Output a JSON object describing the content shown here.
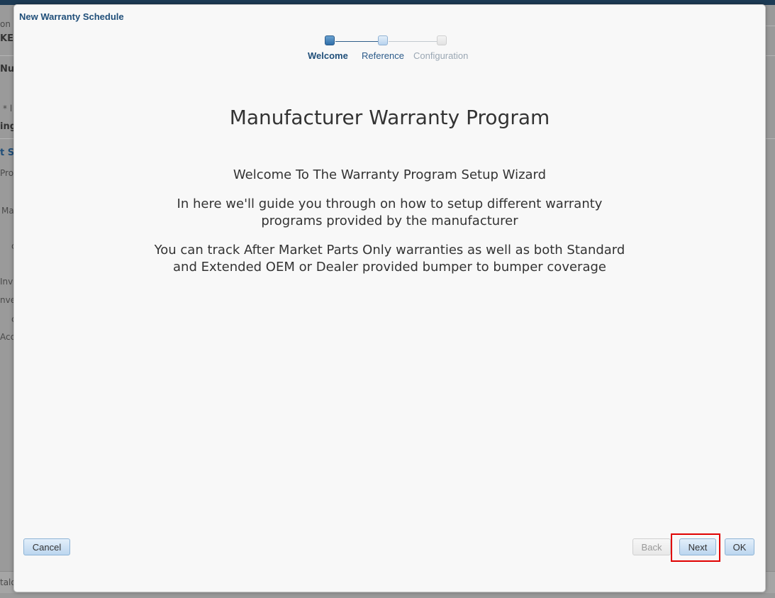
{
  "background": {
    "fragments": [
      "on",
      "KET",
      "Nu",
      "* l",
      "ing",
      "t Se",
      "Pro",
      "Ma",
      "c",
      "Inv",
      "nve",
      "c",
      "Acc",
      "talo"
    ]
  },
  "dialog": {
    "title": "New Warranty Schedule",
    "train": {
      "steps": [
        {
          "label": "Welcome",
          "state": "current"
        },
        {
          "label": "Reference",
          "state": "next"
        },
        {
          "label": "Configuration",
          "state": "disabled"
        }
      ]
    },
    "heading": "Manufacturer Warranty Program",
    "paragraphs": [
      "Welcome To The Warranty Program Setup Wizard",
      "In here we'll guide you through on how to setup different warranty programs provided by the manufacturer",
      "You can track After Market Parts Only warranties as well as both Standard and Extended OEM or Dealer provided bumper to bumper coverage"
    ],
    "paragraph_lines": [
      [
        "Welcome To The Warranty Program Setup Wizard"
      ],
      [
        "In here we'll guide you through on how to setup different warranty",
        "programs provided by the manufacturer"
      ],
      [
        "You can track After Market Parts Only warranties as well as both Standard",
        "and Extended OEM or Dealer provided bumper to bumper coverage"
      ]
    ],
    "buttons": {
      "cancel": "Cancel",
      "back": "Back",
      "next": "Next",
      "ok": "OK"
    }
  },
  "colors": {
    "title": "#1f4e79",
    "highlight": "#e00000",
    "button_accent": "#bcd6ef"
  }
}
